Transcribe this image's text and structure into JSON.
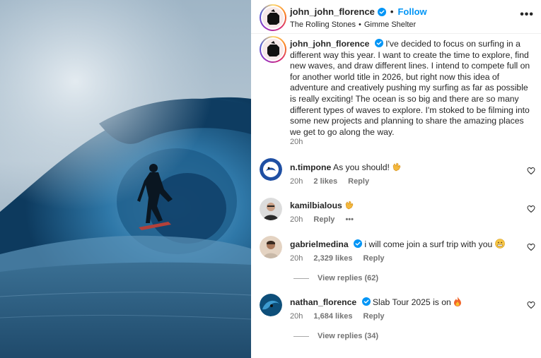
{
  "header": {
    "username": "john_john_florence",
    "separator": "•",
    "follow_label": "Follow",
    "song_artist": "The Rolling Stones",
    "song_separator": "•",
    "song_title": "Gimme Shelter",
    "more_label": "•••"
  },
  "caption": {
    "username": "john_john_florence",
    "text": "I've decided to focus on surfing in a different way this year. I want to create the time to explore, find new waves, and draw different lines. I intend to compete full on for another world title in 2026, but right now this idea of adventure and creatively pushing my surfing as far as possible is really exciting! The ocean is so big and there are so many different types of waves to explore. I'm stoked to be filming into some new projects and planning to share the amazing places we get to go along the way.",
    "time": "20h"
  },
  "comments": [
    {
      "username": "n.timpone",
      "verified": false,
      "text": "As you should!",
      "emoji": "clapping-hands",
      "time": "20h",
      "likes": "2 likes",
      "reply": "Reply"
    },
    {
      "username": "kamilbialous",
      "verified": false,
      "text": "",
      "emoji": "clapping-hands",
      "time": "20h",
      "likes": "",
      "reply": "Reply",
      "more": "•••"
    },
    {
      "username": "gabrielmedina",
      "verified": true,
      "text": "i will come join a surf trip with you",
      "emoji": "grimacing-face",
      "time": "20h",
      "likes": "2,329 likes",
      "reply": "Reply",
      "view_replies": "View replies (62)"
    },
    {
      "username": "nathan_florence",
      "verified": true,
      "text": "Slab Tour 2025 is on",
      "emoji": "fire",
      "time": "20h",
      "likes": "1,684 likes",
      "reply": "Reply",
      "view_replies": "View replies (34)"
    }
  ],
  "colors": {
    "accent": "#0095f6",
    "text": "#262626",
    "secondary": "#737373",
    "verified": "#0095f6"
  }
}
